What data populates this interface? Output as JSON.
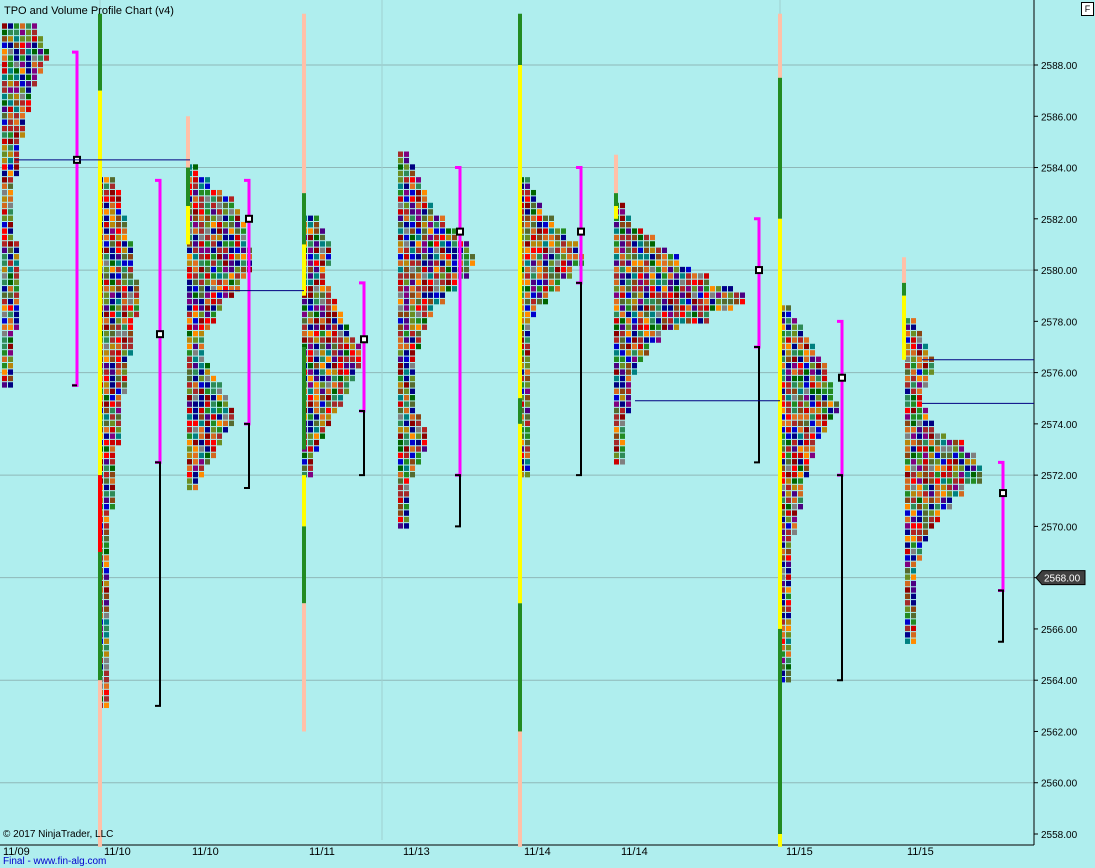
{
  "header": {
    "title": "TPO and Volume Profile Chart (v4)",
    "badge": "F"
  },
  "footer": {
    "copyright": "© 2017 NinjaTrader, LLC",
    "link": "Final - www.fin-alg.com"
  },
  "current_price_label": "2568.00",
  "chart_data": {
    "type": "tpo_profile",
    "title": "TPO and Volume Profile Chart (v4)",
    "y_axis": {
      "min": 2557.5,
      "max": 2589.5,
      "tick_labels": [
        "2588.00",
        "2586.00",
        "2584.00",
        "2582.00",
        "2580.00",
        "2578.00",
        "2576.00",
        "2574.00",
        "2572.00",
        "2570.00",
        "2568.00",
        "2566.00",
        "2564.00",
        "2562.00",
        "2560.00",
        "2558.00"
      ],
      "ticks": [
        2588,
        2586,
        2584,
        2582,
        2580,
        2578,
        2576,
        2574,
        2572,
        2570,
        2568,
        2566,
        2564,
        2562,
        2560,
        2558
      ],
      "position": "right"
    },
    "x_axis": {
      "date_labels": [
        "11/09",
        "11/10",
        "11/10",
        "11/11",
        "11/13",
        "11/14",
        "11/14",
        "11/15",
        "11/15"
      ]
    },
    "grid": true,
    "profiles": [
      {
        "session": "11/09",
        "low": 2575.5,
        "high": 2589.5,
        "poc": 2584.3,
        "va_low": 2575.5,
        "va_high": 2588.5
      },
      {
        "session": "11/10",
        "low": 2563.0,
        "high": 2583.5,
        "poc": 2577.5,
        "va_low": 2572.5,
        "va_high": 2583.5
      },
      {
        "session": "11/10",
        "low": 2571.5,
        "high": 2584.0,
        "poc": 2582.0,
        "va_low": 2574.0,
        "va_high": 2583.5
      },
      {
        "session": "11/11",
        "low": 2572.0,
        "high": 2582.0,
        "poc": 2577.3,
        "va_low": 2574.5,
        "va_high": 2579.5
      },
      {
        "session": "11/13",
        "low": 2570.0,
        "high": 2584.5,
        "poc": 2581.5,
        "va_low": 2572.0,
        "va_high": 2584.0
      },
      {
        "session": "11/14",
        "low": 2572.0,
        "high": 2583.5,
        "poc": 2581.5,
        "va_low": 2579.5,
        "va_high": 2584.0
      },
      {
        "session": "11/14",
        "low": 2572.5,
        "high": 2582.5,
        "poc": 2580.0,
        "va_low": 2577.0,
        "va_high": 2582.0
      },
      {
        "session": "11/15",
        "low": 2564.0,
        "high": 2578.5,
        "poc": 2575.8,
        "va_low": 2572.0,
        "va_high": 2578.0
      },
      {
        "session": "11/15",
        "low": 2565.5,
        "high": 2578.0,
        "poc": 2571.3,
        "va_low": 2567.5,
        "va_high": 2572.5
      }
    ],
    "naked_pocs": [
      2584.3,
      2579.2,
      2574.9,
      2576.5,
      2574.8
    ]
  }
}
